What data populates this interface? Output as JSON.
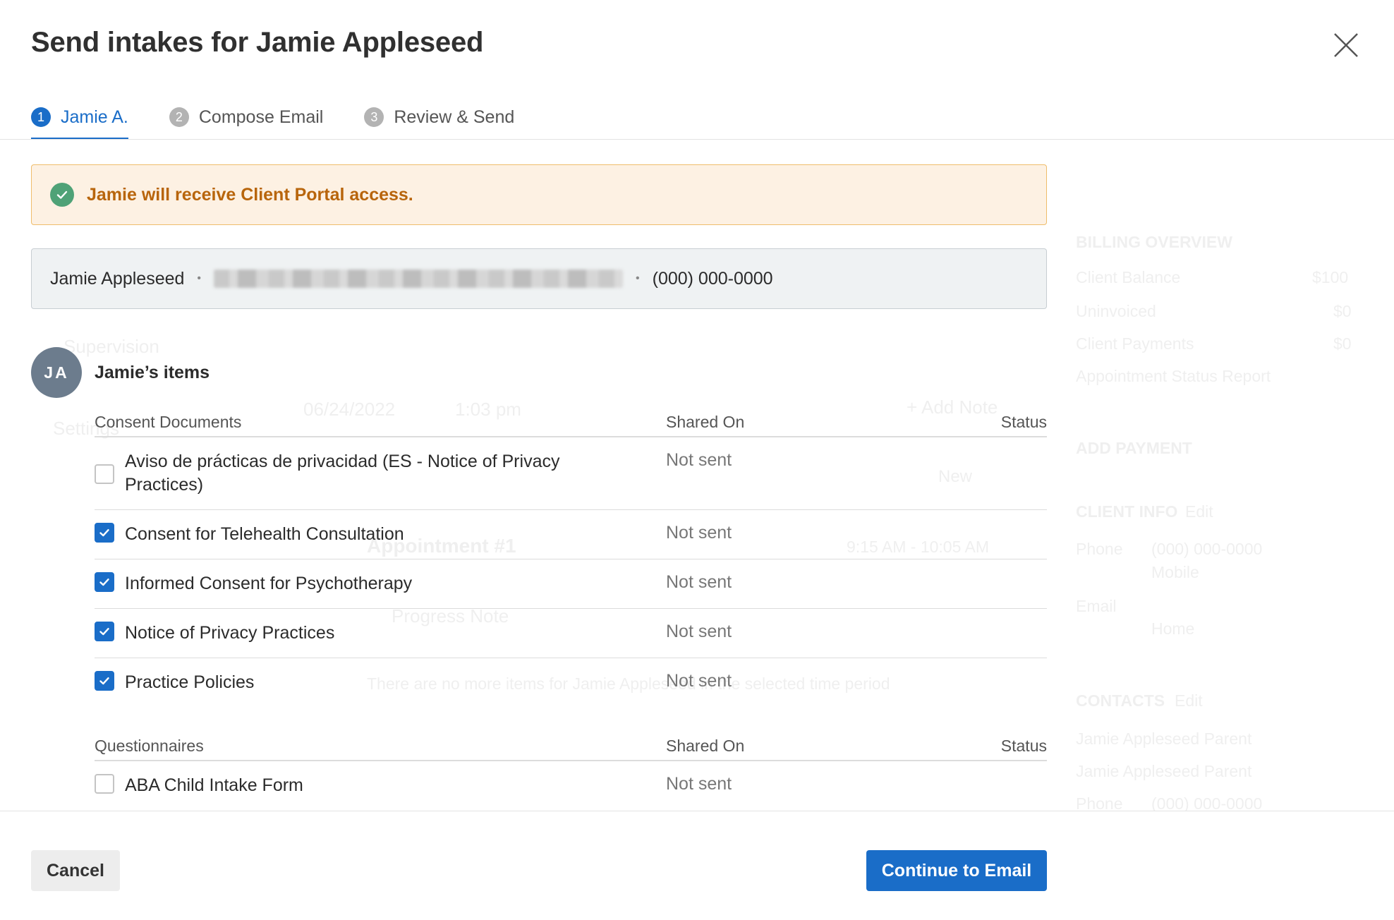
{
  "modal": {
    "title": "Send intakes for Jamie Appleseed",
    "steps": [
      {
        "num": "1",
        "label": "Jamie A."
      },
      {
        "num": "2",
        "label": "Compose Email"
      },
      {
        "num": "3",
        "label": "Review & Send"
      }
    ],
    "alert": {
      "text": "Jamie will receive Client Portal access."
    },
    "contact": {
      "name": "Jamie Appleseed",
      "separator": "•",
      "phone": "(000) 000-0000"
    },
    "client": {
      "initials": "JA",
      "items_title": "Jamie’s items"
    },
    "consent": {
      "headers": {
        "name": "Consent Documents",
        "shared": "Shared On",
        "status": "Status"
      },
      "rows": [
        {
          "name": "Aviso de prácticas de privacidad (ES - Notice of Privacy Practices)",
          "shared": "Not sent",
          "checked": false
        },
        {
          "name": "Consent for Telehealth Consultation",
          "shared": "Not sent",
          "checked": true
        },
        {
          "name": "Informed Consent for Psychotherapy",
          "shared": "Not sent",
          "checked": true
        },
        {
          "name": "Notice of Privacy Practices",
          "shared": "Not sent",
          "checked": true
        },
        {
          "name": "Practice Policies",
          "shared": "Not sent",
          "checked": true
        }
      ]
    },
    "questionnaires": {
      "headers": {
        "name": "Questionnaires",
        "shared": "Shared On",
        "status": "Status"
      },
      "rows": [
        {
          "name": "ABA Child Intake Form",
          "shared": "Not sent",
          "checked": false
        }
      ]
    },
    "footer": {
      "cancel_label": "Cancel",
      "continue_label": "Continue to Email"
    }
  },
  "background": {
    "texts": [
      "BILLING OVERVIEW",
      "Client Balance",
      "$100",
      "Uninvoiced",
      "$0",
      "Client Payments",
      "$0",
      "Appointment Status Report",
      "ADD PAYMENT",
      "CLIENT INFO",
      "Edit",
      "Phone",
      "(000) 000-0000",
      "Mobile",
      "Email",
      "Home",
      "CONTACTS",
      "Edit",
      "Jamie Appleseed Parent",
      "Jamie Appleseed Parent",
      "Phone",
      "(000) 000-0000",
      "Supervision",
      "Settings",
      "06/24/2022",
      "1:03 pm",
      "+ Add Note",
      "New",
      "Appointment #1",
      "9:15 AM - 10:05 AM",
      "Progress Note",
      "There are no more items for Jamie Appleseed in the selected time period"
    ]
  },
  "colors": {
    "primary": "#1a6dc8",
    "alert_bg": "#fdf1e3",
    "alert_border": "#efbd6b",
    "alert_text": "#b8650c",
    "success": "#4fa277",
    "avatar": "#6c7c8d"
  }
}
